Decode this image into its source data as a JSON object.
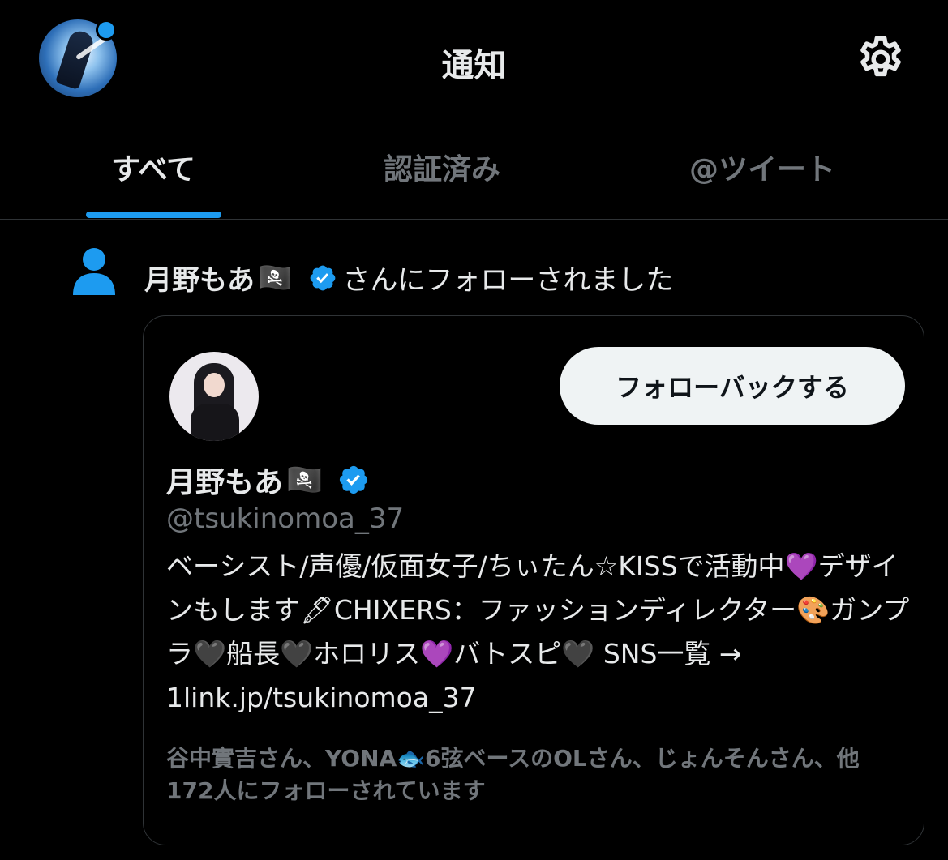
{
  "header": {
    "title": "通知",
    "avatar_icon": "profile-avatar",
    "settings_icon": "gear-icon"
  },
  "tabs": [
    {
      "label": "すべて",
      "active": true
    },
    {
      "label": "認証済み",
      "active": false
    },
    {
      "label": "@ツイート",
      "active": false
    }
  ],
  "notification": {
    "icon": "person-icon",
    "user_name": "月野もあ",
    "flag": "🏴‍☠️",
    "action_text": "さんにフォローされました"
  },
  "card": {
    "follow_button_label": "フォローバックする",
    "name": "月野もあ",
    "flag": "🏴‍☠️",
    "handle": "@tsukinomoa_37",
    "bio": "ベーシスト/声優/仮面女子/ちぃたん☆KISSで活動中💜デザインもします🖋CHIXERS：ファッションディレクター🎨ガンプラ🖤船長🖤ホロリス💜バトスピ🖤 SNS一覧 → 1link.jp/tsukinomoa_37",
    "followed_by": "谷中實吉さん、YONA🐟6弦ベースのOLさん、じょんそんさん、他172人にフォローされています"
  },
  "colors": {
    "accent": "#1d9bf0",
    "background": "#000000",
    "text_primary": "#e7e9ea",
    "text_secondary": "#71767b"
  }
}
